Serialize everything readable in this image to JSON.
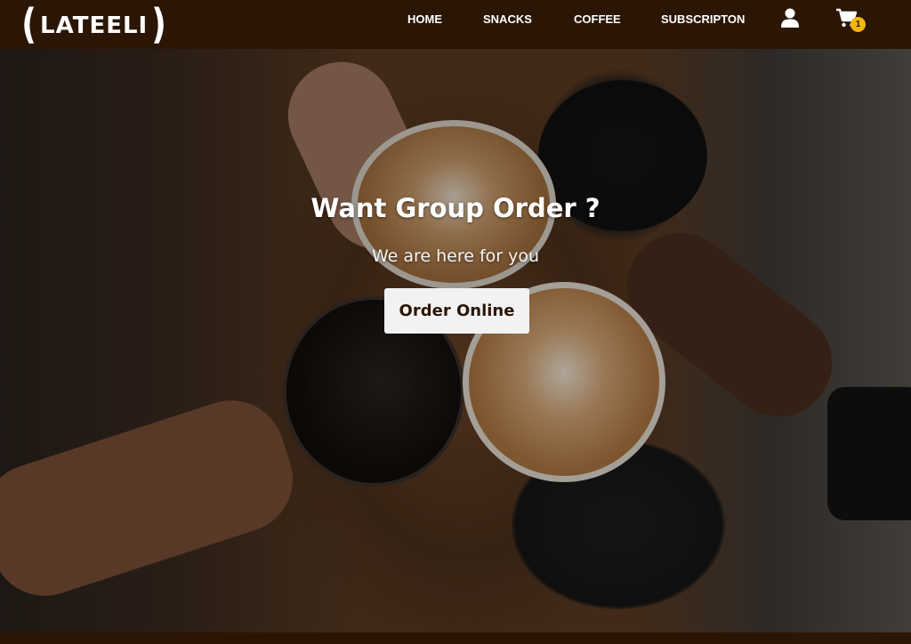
{
  "brand": {
    "logo_text": "LATEELI"
  },
  "nav": {
    "links": [
      "HOME",
      "SNACKS",
      "COFFEE",
      "SUBSCRIPTON"
    ],
    "user_icon": "user-icon",
    "cart_icon": "cart-icon",
    "cart_count": "1"
  },
  "hero": {
    "title": "Want Group Order ?",
    "subtitle": "We are here for you",
    "cta_label": "Order Online"
  },
  "colors": {
    "navbar_bg": "#2b1606",
    "badge": "#f2b70f",
    "button_bg": "#f2f2f2",
    "button_text": "#2b1606"
  }
}
